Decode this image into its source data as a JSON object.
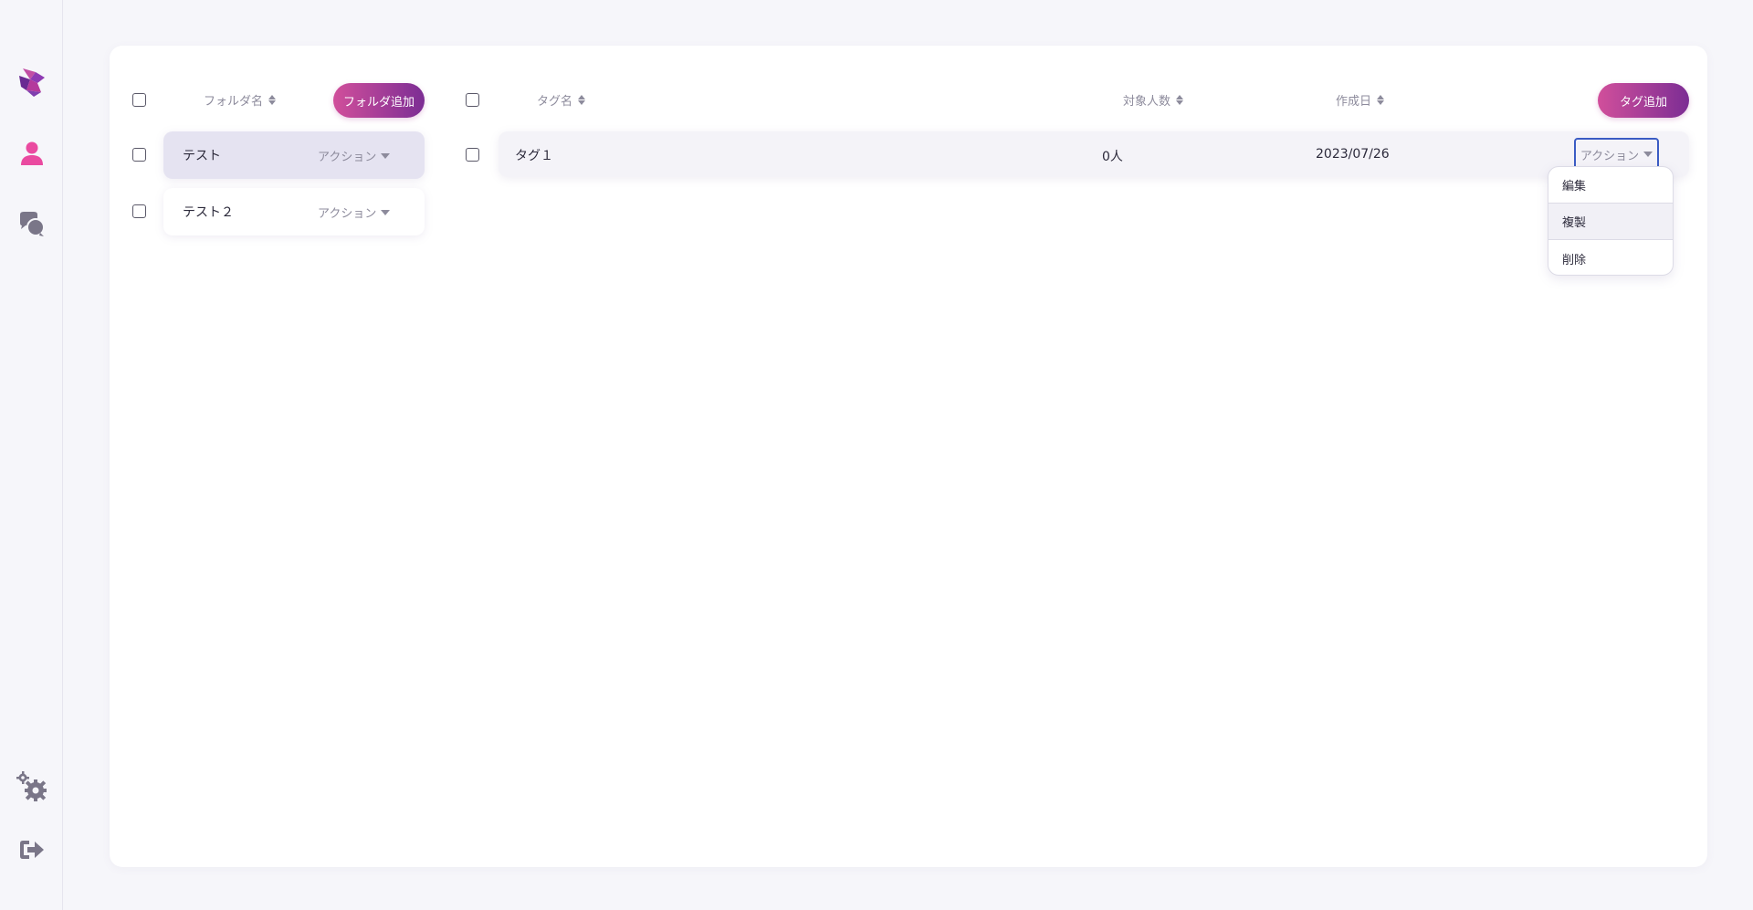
{
  "sidebar": {
    "icons": [
      "logo-icon",
      "user-icon",
      "chat-icon",
      "settings-icon",
      "logout-icon"
    ]
  },
  "folders": {
    "header_label": "フォルダ名",
    "add_button": "フォルダ追加",
    "items": [
      {
        "name": "テスト",
        "action": "アクション",
        "selected": true
      },
      {
        "name": "テスト２",
        "action": "アクション",
        "selected": false
      }
    ]
  },
  "tags": {
    "header_name": "タグ名",
    "header_count": "対象人数",
    "header_date": "作成日",
    "add_button": "タグ追加",
    "rows": [
      {
        "name": "タグ１",
        "count": "0人",
        "date": "2023/07/26",
        "action": "アクション"
      }
    ]
  },
  "action_menu": {
    "items": [
      "編集",
      "複製",
      "削除"
    ],
    "hovered": "複製"
  },
  "colors": {
    "accent_start": "#d14f9b",
    "accent_end": "#7c2d94",
    "user_icon": "#ea4aa0",
    "focus_border": "#3b5cc4"
  }
}
